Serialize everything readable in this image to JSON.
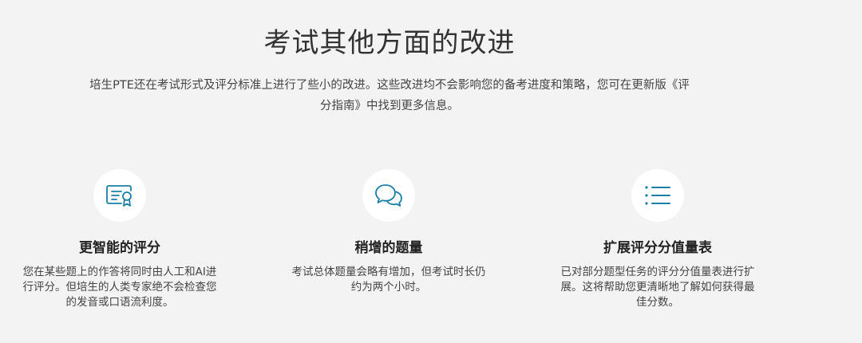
{
  "section": {
    "title": "考试其他方面的改进",
    "intro": "培生PTE还在考试形式及评分标准上进行了些小的改进。这些改进均不会影响您的备考进度和策略，您可在更新版《评分指南》中找到更多信息。"
  },
  "features": [
    {
      "icon": "certificate-icon",
      "title": "更智能的评分",
      "description": "您在某些题上的作答将同时由人工和AI进行评分。但培生的人类专家绝不会检查您的发音或口语流利度。"
    },
    {
      "icon": "chat-bubbles-icon",
      "title": "稍增的题量",
      "description": "考试总体题量会略有增加，但考试时长仍约为两个小时。"
    },
    {
      "icon": "list-icon",
      "title": "扩展评分分值量表",
      "description": "已对部分题型任务的评分分值量表进行扩展。这将帮助您更清晰地了解如何获得最佳分数。"
    }
  ],
  "colors": {
    "background": "#f3f3f3",
    "icon_accent": "#1a7fa6",
    "icon_circle": "#ffffff",
    "heading_text": "#333333"
  }
}
